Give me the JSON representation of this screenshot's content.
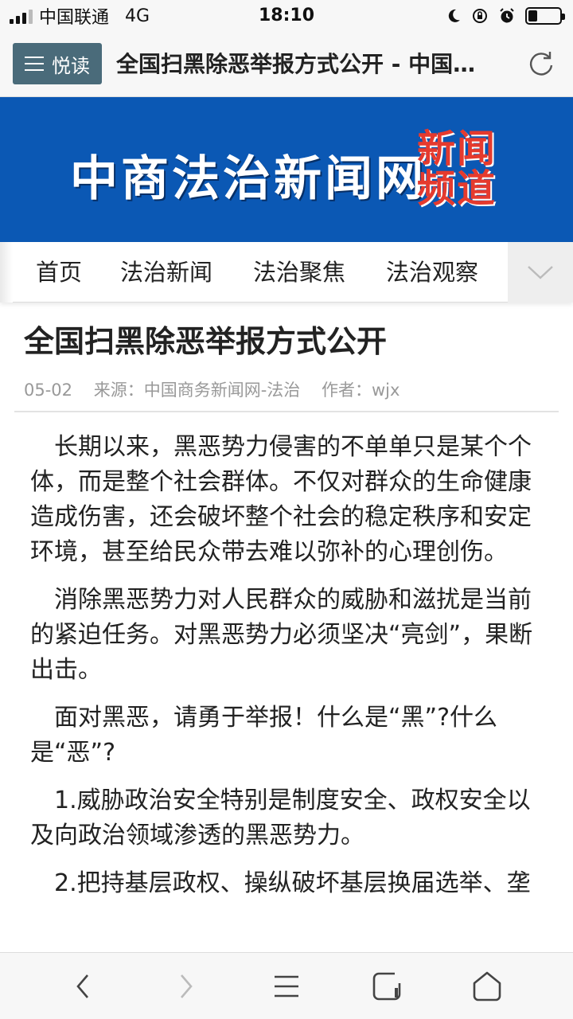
{
  "status_bar": {
    "carrier": "中国联通",
    "network": "4G",
    "time": "18:10"
  },
  "browser": {
    "reader_label": "悦读",
    "page_title": "全国扫黑除恶举报方式公开 - 中国…"
  },
  "banner": {
    "site_name": "中商法治新闻网",
    "channel_line1": "新闻",
    "channel_line2": "频道",
    "background": "#0b58b4",
    "channel_color": "#e53a2e"
  },
  "nav": {
    "items": [
      "首页",
      "法治新闻",
      "法治聚焦",
      "法治观察"
    ]
  },
  "article": {
    "title": "全国扫黑除恶举报方式公开",
    "date": "05-02",
    "source": "来源：中国商务新闻网-法治",
    "author": "作者：wjx",
    "paragraphs": [
      "长期以来，黑恶势力侵害的不单单只是某个个体，而是整个社会群体。不仅对群众的生命健康造成伤害，还会破坏整个社会的稳定秩序和安定环境，甚至给民众带去难以弥补的心理创伤。",
      "消除黑恶势力对人民群众的威胁和滋扰是当前的紧迫任务。对黑恶势力必须坚决“亮剑”，果断出击。",
      "面对黑恶，请勇于举报！什么是“黑”?什么是“恶”?",
      "1.威胁政治安全特别是制度安全、政权安全以及向政治领域渗透的黑恶势力。",
      "2.把持基层政权、操纵破坏基层换届选举、垄"
    ]
  },
  "toolbar": {
    "icons": [
      "back-icon",
      "forward-icon",
      "menu-icon",
      "tabs-icon",
      "home-icon"
    ]
  }
}
